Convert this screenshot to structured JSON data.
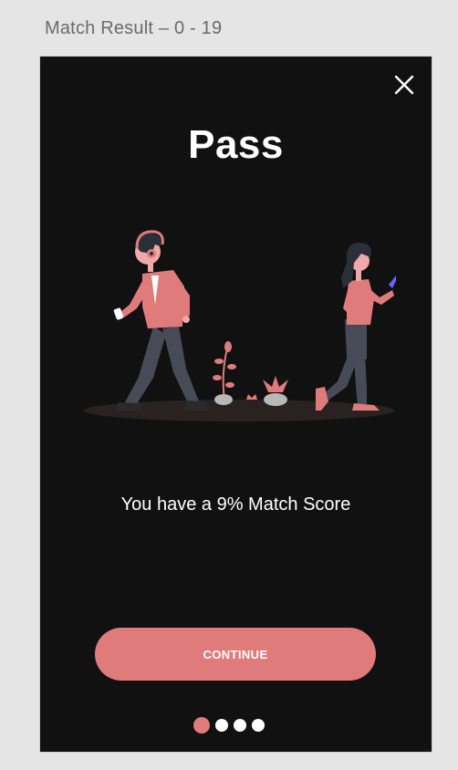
{
  "frame_label": "Match Result – 0 - 19",
  "title": "Pass",
  "score_text": "You have a 9% Match Score",
  "continue_label": "CONTINUE",
  "pager": {
    "total": 4,
    "active": 0
  },
  "icons": {
    "close": "close-icon",
    "illustration": "walking-people-illustration"
  },
  "colors": {
    "background": "#111111",
    "accent": "#e07b7b",
    "text": "#ffffff",
    "dot_inactive": "#ffffff",
    "canvas": "#e5e5e5"
  }
}
